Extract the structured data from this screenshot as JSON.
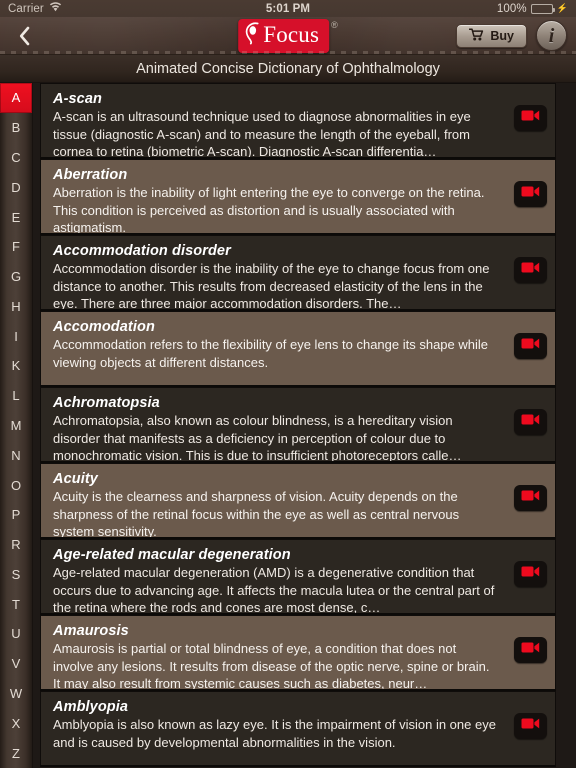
{
  "status_bar": {
    "carrier": "Carrier",
    "wifi_icon": "wifi-icon",
    "time": "5:01 PM",
    "battery_percent": "100%",
    "battery_icon": "battery-full-icon",
    "charging_icon": "lightning-bolt-icon"
  },
  "nav": {
    "back_icon": "chevron-left-icon",
    "logo_text": "Focus",
    "logo_mark_icon": "eye-profile-logo-icon",
    "logo_registered": "®",
    "buy_label": "Buy",
    "cart_icon": "shopping-cart-icon",
    "info_label": "i",
    "info_icon": "info-circle-icon"
  },
  "subtitle": "Animated Concise Dictionary of Ophthalmology",
  "colors": {
    "accent_red": "#d6102a",
    "active_index": "#f01020",
    "leather_brown": "#48372f",
    "row_dark": "#2c2721",
    "row_light": "#6b5a4c",
    "page_background": "#1e1916"
  },
  "sidebar": {
    "active_letter": "A",
    "letters": [
      "A",
      "B",
      "C",
      "D",
      "E",
      "F",
      "G",
      "H",
      "I",
      "K",
      "L",
      "M",
      "N",
      "O",
      "P",
      "R",
      "S",
      "T",
      "U",
      "V",
      "W",
      "X",
      "Z"
    ]
  },
  "entries": [
    {
      "term": "A-scan",
      "description": "A-scan is an ultrasound technique used to diagnose abnormalities in eye tissue (diagnostic A-scan) and to measure the length of the eyeball, from cornea to retina (biometric A-scan). Diagnostic A-scan differentia…",
      "video_icon": "video-camera-icon"
    },
    {
      "term": "Aberration",
      "description": "Aberration is the inability of light entering the eye to converge on the retina. This condition is perceived as distortion and is usually associated with astigmatism.",
      "video_icon": "video-camera-icon"
    },
    {
      "term": "Accommodation disorder",
      "description": "Accommodation disorder is the inability of the eye to change focus from one distance to another. This results from decreased elasticity of the lens in the eye. There are three major accommodation disorders. The…",
      "video_icon": "video-camera-icon"
    },
    {
      "term": "Accomodation",
      "description": "Accommodation refers to the flexibility of eye lens to change its shape while viewing objects at different distances.",
      "video_icon": "video-camera-icon"
    },
    {
      "term": "Achromatopsia",
      "description": "Achromatopsia, also known as colour blindness, is a hereditary vision disorder that manifests as a deficiency in perception of colour due to monochromatic vision. This is due to insufficient photoreceptors calle…",
      "video_icon": "video-camera-icon"
    },
    {
      "term": "Acuity",
      "description": "Acuity is the clearness and sharpness of vision. Acuity depends on the sharpness of the retinal focus within the eye as well as central nervous system sensitivity.",
      "video_icon": "video-camera-icon"
    },
    {
      "term": "Age-related macular degeneration",
      "description": "Age-related macular degeneration (AMD) is a degenerative condition that occurs due to advancing age. It affects the macula lutea or the central part of the retina where the rods and cones are most dense, c…",
      "video_icon": "video-camera-icon"
    },
    {
      "term": "Amaurosis",
      "description": "Amaurosis is partial or total blindness of eye, a condition that does not involve any lesions. It results from disease of the optic nerve, spine or brain. It may also result from systemic causes such as diabetes, neur…",
      "video_icon": "video-camera-icon"
    },
    {
      "term": "Amblyopia",
      "description": "Amblyopia is also known as lazy eye. It is the impairment of vision in one eye and is caused by developmental abnormalities in the vision.",
      "video_icon": "video-camera-icon"
    }
  ]
}
